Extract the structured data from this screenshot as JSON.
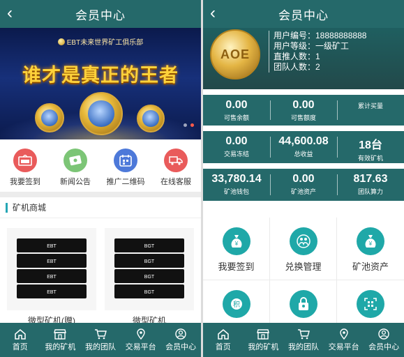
{
  "left": {
    "header": {
      "title": "会员中心"
    },
    "banner": {
      "club": "EBT未来世界矿工俱乐部",
      "slogan": "谁才是真正的王者"
    },
    "quick": [
      {
        "label": "我要签到",
        "icon": "sign-in-icon",
        "color": "#e95b5b"
      },
      {
        "label": "新闻公告",
        "icon": "news-icon",
        "color": "#7cc576"
      },
      {
        "label": "推广二维码",
        "icon": "qrcode-icon",
        "color": "#4d79d9"
      },
      {
        "label": "在线客服",
        "icon": "truck-icon",
        "color": "#e95b5b"
      }
    ],
    "section_title": "矿机商城",
    "products": [
      {
        "name": "微型矿机(赠)",
        "tag": "EBT"
      },
      {
        "name": "微型矿机",
        "tag": "BGT"
      }
    ]
  },
  "right": {
    "header": {
      "title": "会员中心"
    },
    "avatar_text": "AOE",
    "profile": [
      "用户编号：18888888888",
      "用户等级：一级矿工",
      "直推人数：1",
      "团队人数：2"
    ],
    "row1": [
      {
        "value": "0.00",
        "label": "可售余额"
      },
      {
        "value": "0.00",
        "label": "可售额度"
      },
      {
        "value": "",
        "label": "累计买量"
      }
    ],
    "row2": [
      {
        "value": "0.00",
        "label": "交易冻结"
      },
      {
        "value": "44,600.08",
        "label": "总收益"
      },
      {
        "value": "18台",
        "label": "有效矿机"
      }
    ],
    "row3": [
      {
        "value": "33,780.14",
        "label": "矿池钱包"
      },
      {
        "value": "0.00",
        "label": "矿池资产"
      },
      {
        "value": "817.63",
        "label": "团队算力"
      }
    ],
    "grid": [
      {
        "label": "我要签到",
        "icon": "money-bag-icon"
      },
      {
        "label": "兑换管理",
        "icon": "exchange-icon"
      },
      {
        "label": "矿池资产",
        "icon": "money-bag-icon"
      },
      {
        "label": "",
        "icon": "points-icon"
      },
      {
        "label": "",
        "icon": "security-icon"
      },
      {
        "label": "",
        "icon": "qrcode-icon"
      }
    ]
  },
  "tabbar": [
    {
      "label": "首页",
      "icon": "home-icon"
    },
    {
      "label": "我的矿机",
      "icon": "shop-icon"
    },
    {
      "label": "我的团队",
      "icon": "cart-icon"
    },
    {
      "label": "交易平台",
      "icon": "location-icon"
    },
    {
      "label": "会员中心",
      "icon": "user-icon"
    }
  ],
  "colors": {
    "primary": "#25696a",
    "accent": "#1fa8a8"
  }
}
